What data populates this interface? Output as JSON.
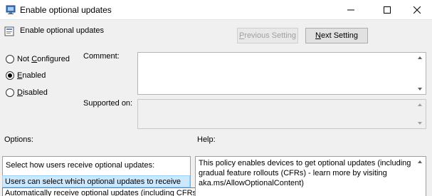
{
  "window": {
    "title": "Enable optional updates",
    "minimize_icon": "minimize-icon",
    "maximize_icon": "maximize-icon",
    "close_icon": "close-icon"
  },
  "header": {
    "policy_title": "Enable optional updates",
    "prev_button": {
      "pre": "",
      "u": "P",
      "post": "revious Setting"
    },
    "next_button": {
      "pre": "",
      "u": "N",
      "post": "ext Setting"
    }
  },
  "state": {
    "options": [
      {
        "pre": "Not ",
        "u": "C",
        "post": "onfigured",
        "checked": false
      },
      {
        "pre": "",
        "u": "E",
        "post": "nabled",
        "checked": true
      },
      {
        "pre": "",
        "u": "D",
        "post": "isabled",
        "checked": false
      }
    ]
  },
  "labels": {
    "comment": "Comment:",
    "supported_on": "Supported on:",
    "options": "Options:",
    "help": "Help:"
  },
  "options_panel": {
    "prompt": "Select how users receive optional updates:",
    "selected_value": "Users can select which optional updates to receive",
    "dropdown_option": "Automatically receive optional updates (including CFRs)"
  },
  "help_panel": {
    "lines": [
      "This policy enables devices to get optional updates (including",
      "gradual feature rollouts (CFRs) - learn more by visiting",
      "aka.ms/AllowOptionalContent)"
    ]
  }
}
